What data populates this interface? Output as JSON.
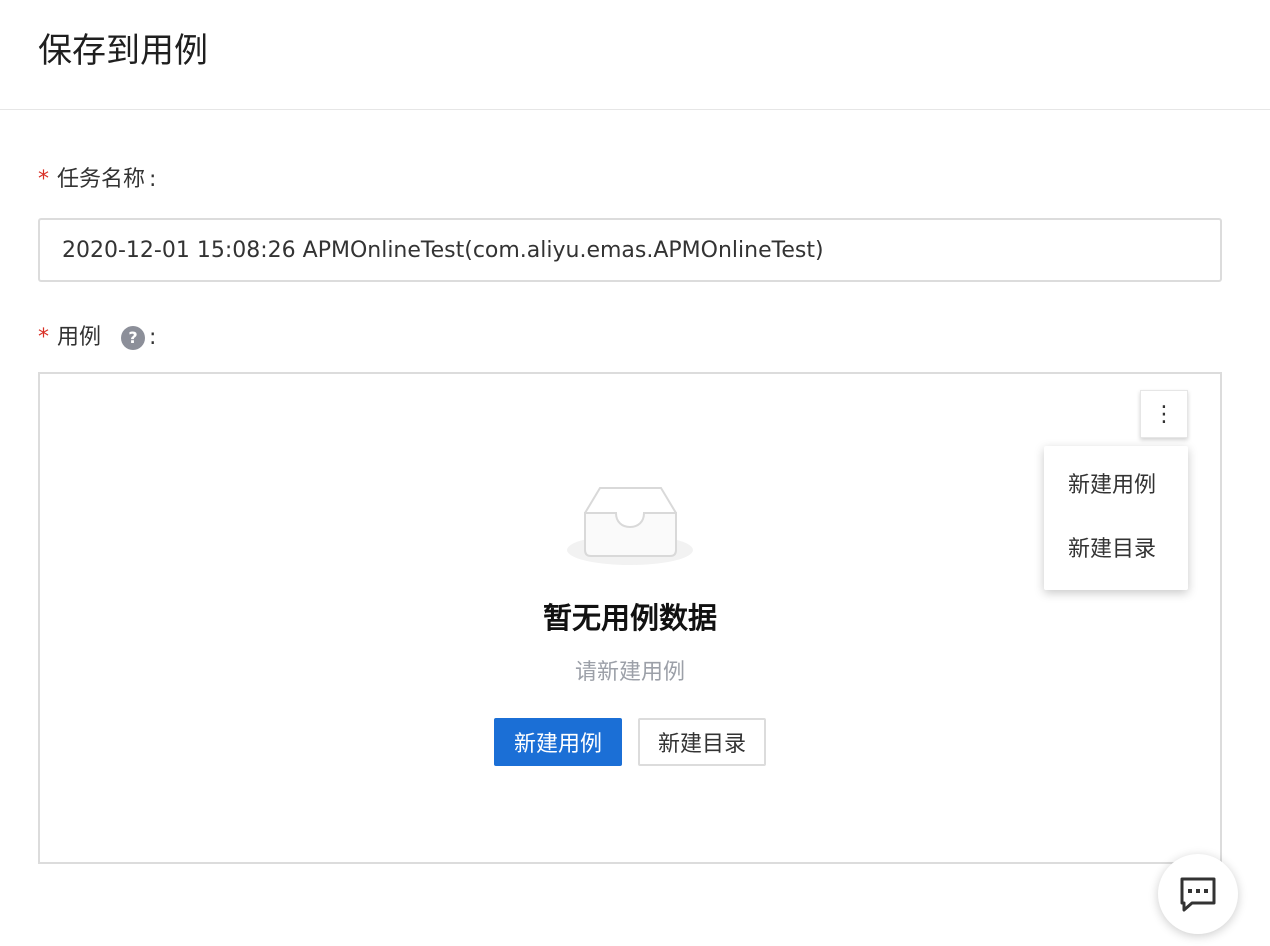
{
  "header": {
    "title": "保存到用例"
  },
  "task_name": {
    "required_mark": "*",
    "label": "任务名称",
    "colon": ":",
    "value": "2020-12-01 15:08:26 APMOnlineTest(com.aliyu.emas.APMOnlineTest)"
  },
  "case": {
    "required_mark": "*",
    "label": "用例",
    "help_icon_glyph": "?",
    "colon": ":",
    "more_glyph": "⋮",
    "menu": {
      "items": [
        {
          "label": "新建用例"
        },
        {
          "label": "新建目录"
        }
      ]
    },
    "empty": {
      "icon": "inbox-empty-icon",
      "title": "暂无用例数据",
      "subtitle": "请新建用例",
      "primary_button": "新建用例",
      "secondary_button": "新建目录"
    }
  },
  "chat": {
    "icon": "chat-icon"
  },
  "colors": {
    "primary": "#1b6fd6",
    "required": "#d93026",
    "border": "#dcdcdc",
    "muted_text": "#9ca0a8"
  }
}
